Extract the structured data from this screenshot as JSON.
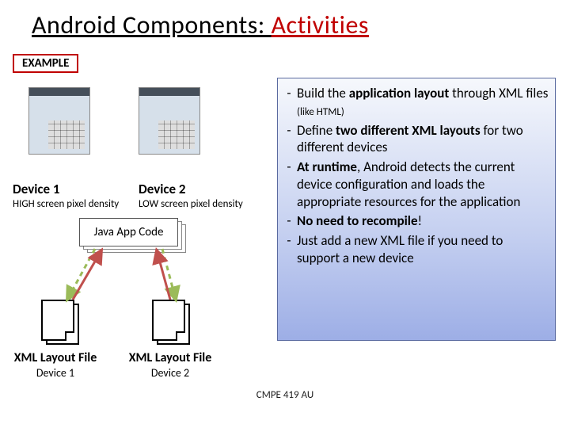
{
  "title_part1": "Android Components: ",
  "title_part2": "Activities",
  "example_label": "EXAMPLE",
  "device1_label": "Device 1",
  "device2_label": "Device 2",
  "device1_sub": "HIGH screen pixel density",
  "device2_sub": "LOW screen pixel density",
  "java_box": "Java App Code",
  "xml_label1": "XML Layout File",
  "xml_label2": "XML Layout File",
  "xml_sub1": "Device 1",
  "xml_sub2": "Device 2",
  "footer": "CMPE 419 AU",
  "bullets": [
    {
      "pre": "Build the ",
      "b": "application layout",
      "post1": " through XML files ",
      "small": "(like HTML)"
    },
    {
      "pre": "Define ",
      "b": "two different XML layouts",
      "post1": " for two different devices"
    },
    {
      "b": "At runtime",
      "post1": ", Android detects the current device configuration and loads the appropriate resources for the application"
    },
    {
      "b": "No need to recompile",
      "post1": "!"
    },
    {
      "post1": "Just add a new XML file if you need to support a new device"
    }
  ]
}
